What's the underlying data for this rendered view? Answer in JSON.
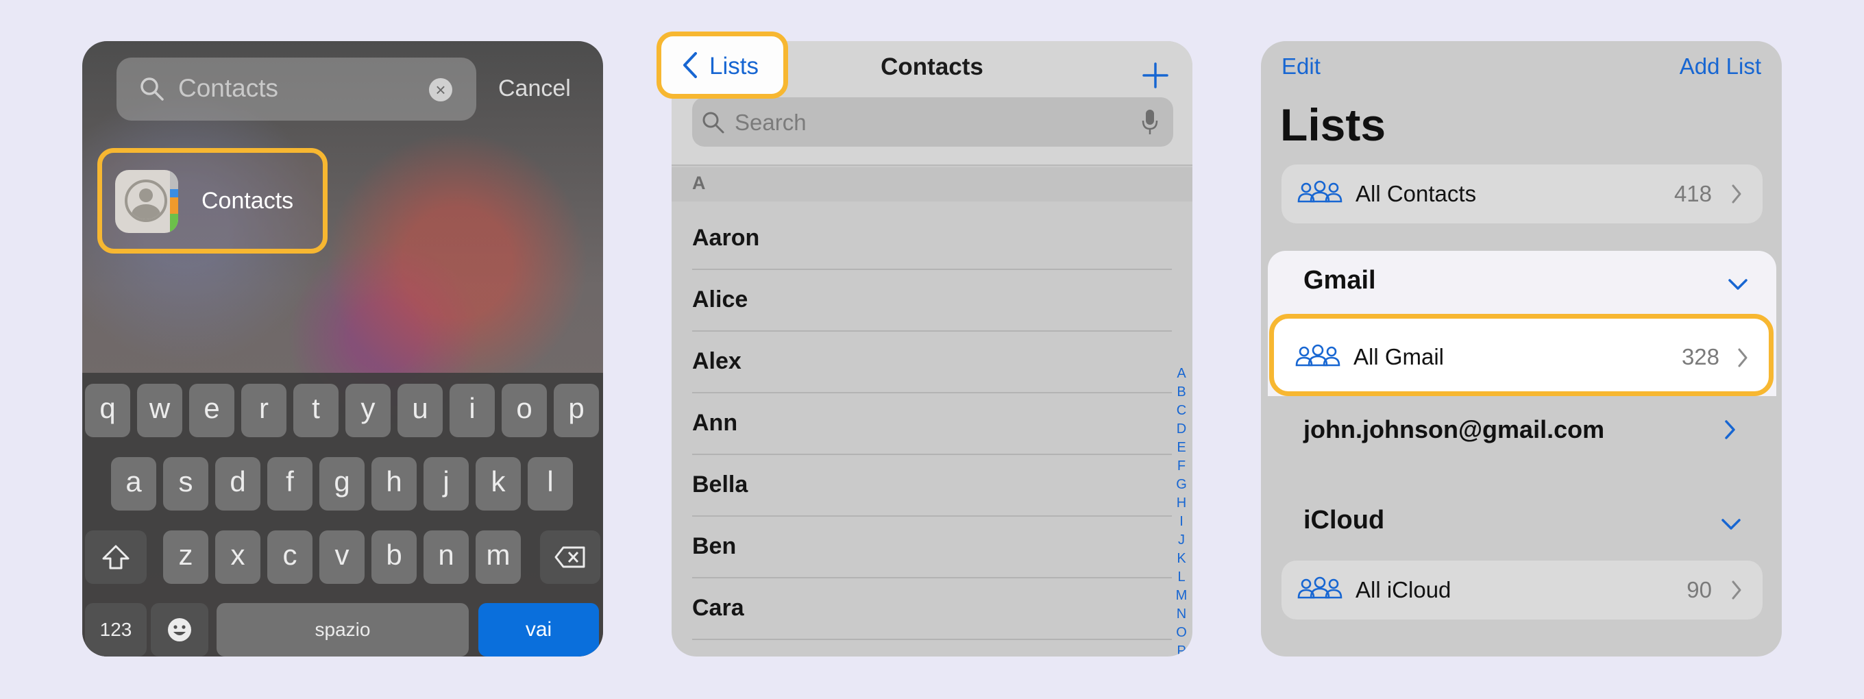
{
  "spotlight": {
    "query": "Contacts",
    "cancel": "Cancel",
    "result_label": "Contacts",
    "keyboard": {
      "row1": [
        "q",
        "w",
        "e",
        "r",
        "t",
        "y",
        "u",
        "i",
        "o",
        "p"
      ],
      "row2": [
        "a",
        "s",
        "d",
        "f",
        "g",
        "h",
        "j",
        "k",
        "l"
      ],
      "row3": [
        "z",
        "x",
        "c",
        "v",
        "b",
        "n",
        "m"
      ],
      "numbers": "123",
      "space": "spazio",
      "go": "vai"
    }
  },
  "contacts": {
    "back_label": "Lists",
    "title": "Contacts",
    "search_placeholder": "Search",
    "section": "A",
    "names": [
      "Aaron",
      "Alice",
      "Alex",
      "Ann",
      "Bella",
      "Ben",
      "Cara"
    ],
    "index_letters": [
      "A",
      "B",
      "C",
      "D",
      "E",
      "F",
      "G",
      "H",
      "I",
      "J",
      "K",
      "L",
      "M",
      "N",
      "O",
      "P"
    ]
  },
  "lists": {
    "edit": "Edit",
    "add_list": "Add List",
    "title": "Lists",
    "all_contacts": {
      "name": "All Contacts",
      "count": "418"
    },
    "gmail_group": "Gmail",
    "all_gmail": {
      "name": "All Gmail",
      "count": "328"
    },
    "account": "john.johnson@gmail.com",
    "icloud_group": "iCloud",
    "all_icloud": {
      "name": "All iCloud",
      "count": "90"
    }
  },
  "colors": {
    "accent_blue": "#1766d2",
    "highlight": "#f7b731",
    "go_key": "#0a6fdc"
  }
}
